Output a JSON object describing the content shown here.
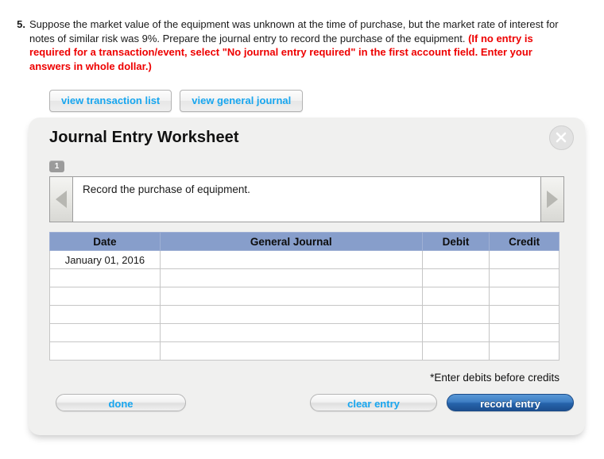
{
  "question": {
    "number": "5.",
    "body_plain": "Suppose the market value of the equipment was unknown at the time of purchase, but the market rate of interest for notes of similar risk was 9%. Prepare the journal entry to record the purchase of the equipment. ",
    "body_highlight": "(If no entry is required for a transaction/event, select \"No journal entry required\" in the first account field. Enter your answers in whole dollar.)",
    "highlight_color": "#ee0000"
  },
  "view_buttons": {
    "transaction_list": "view transaction list",
    "general_journal": "view general journal",
    "link_color": "#18a6ef"
  },
  "panel": {
    "title": "Journal Entry Worksheet",
    "close_icon": "close-circle-icon",
    "step_tab": "1",
    "prompt": "Record the purchase of equipment.",
    "prev_icon": "triangle-left-icon",
    "next_icon": "triangle-right-icon"
  },
  "table": {
    "header_color": "#879ecb",
    "input_border_color": "#f3f000",
    "columns": [
      "Date",
      "General Journal",
      "Debit",
      "Credit"
    ],
    "rows": [
      {
        "date": "January 01, 2016",
        "general_journal": "",
        "debit": "",
        "credit": ""
      },
      {
        "date": "",
        "general_journal": "",
        "debit": "",
        "credit": ""
      },
      {
        "date": "",
        "general_journal": "",
        "debit": "",
        "credit": ""
      },
      {
        "date": "",
        "general_journal": "",
        "debit": "",
        "credit": ""
      },
      {
        "date": "",
        "general_journal": "",
        "debit": "",
        "credit": ""
      },
      {
        "date": "",
        "general_journal": "",
        "debit": "",
        "credit": ""
      }
    ],
    "note": "*Enter debits before credits"
  },
  "footer": {
    "done": "done",
    "clear_entry": "clear entry",
    "record_entry": "record entry",
    "record_entry_color": "#2663ab"
  }
}
